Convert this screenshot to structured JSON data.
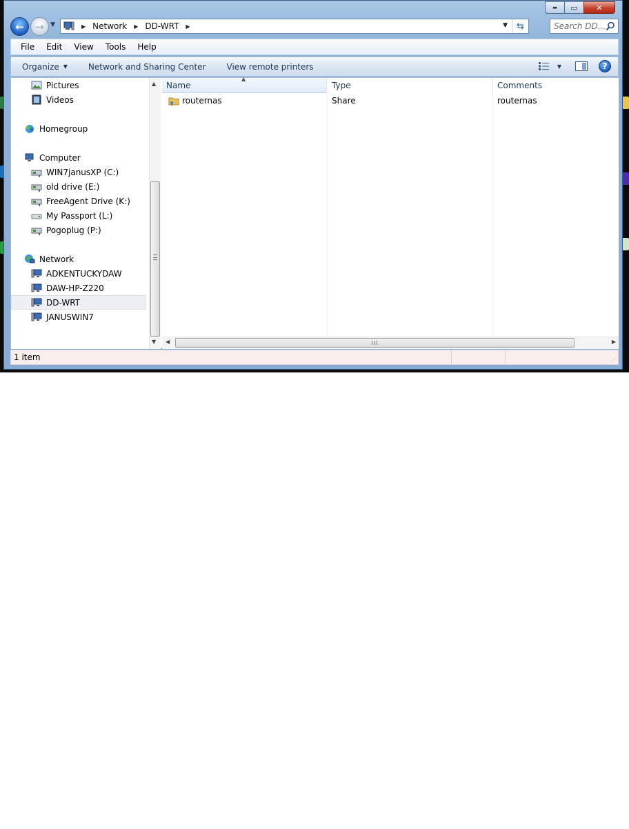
{
  "window": {
    "caption_buttons": {
      "minimize": "▬",
      "maximize": "▭",
      "close": "✕"
    }
  },
  "navigation": {
    "breadcrumb": [
      "Network",
      "DD-WRT"
    ],
    "search_placeholder": "Search DD..."
  },
  "menu": {
    "items": [
      "File",
      "Edit",
      "View",
      "Tools",
      "Help"
    ]
  },
  "commands": {
    "organize": "Organize",
    "network_sharing": "Network and Sharing Center",
    "remote_printers": "View remote printers",
    "help": "?"
  },
  "nav_pane": {
    "items": [
      {
        "label": "Pictures",
        "icon": "pictures-icon"
      },
      {
        "label": "Videos",
        "icon": "videos-icon"
      },
      {
        "label": "Homegroup",
        "icon": "homegroup-icon"
      },
      {
        "label": "Computer",
        "icon": "computer-icon"
      },
      {
        "label": "WIN7janusXP (C:)",
        "icon": "network-drive-icon"
      },
      {
        "label": "old drive (E:)",
        "icon": "network-drive-icon"
      },
      {
        "label": "FreeAgent Drive (K:)",
        "icon": "network-drive-icon"
      },
      {
        "label": "My Passport (L:)",
        "icon": "drive-icon"
      },
      {
        "label": "Pogoplug (P:)",
        "icon": "network-drive-icon"
      },
      {
        "label": "Network",
        "icon": "network-icon"
      },
      {
        "label": "ADKENTUCKYDAW",
        "icon": "computer-icon"
      },
      {
        "label": "DAW-HP-Z220",
        "icon": "computer-icon"
      },
      {
        "label": "DD-WRT",
        "icon": "computer-icon",
        "selected": true
      },
      {
        "label": "JANUSWIN7",
        "icon": "computer-icon"
      }
    ]
  },
  "file_list": {
    "columns": [
      "Name",
      "Type",
      "Comments"
    ],
    "rows": [
      {
        "name": "routernas",
        "type": "Share",
        "comments": "routernas",
        "icon": "shared-folder-icon"
      }
    ]
  },
  "status": {
    "item_count": "1 item"
  },
  "colors": {
    "window_frame": "#8fb3da",
    "status_bar": "#fbefee",
    "selection": "#eef0f3"
  }
}
